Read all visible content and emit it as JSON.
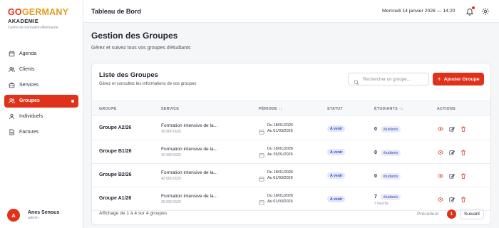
{
  "brand": {
    "go": "GO",
    "rest": "GERMANY",
    "sub": "AKADEMIE",
    "tagline": "Centre de Formation Allemande"
  },
  "sidebar": {
    "items": [
      {
        "label": "Agenda",
        "icon": "calendar-icon"
      },
      {
        "label": "Clients",
        "icon": "users-icon"
      },
      {
        "label": "Services",
        "icon": "briefcase-icon"
      },
      {
        "label": "Groupes",
        "icon": "group-icon",
        "active": true
      },
      {
        "label": "Individuels",
        "icon": "user-icon"
      },
      {
        "label": "Factures",
        "icon": "invoice-icon"
      }
    ]
  },
  "user": {
    "initial": "A",
    "name": "Anes Senous",
    "role": "admin"
  },
  "header": {
    "title": "Tableau de Bord",
    "datetime": "Mercredi 14 janvier 2026 — 14:20"
  },
  "page": {
    "title": "Gestion des Groupes",
    "subtitle": "Gérez et suivez tous vos groupes d'étudiants"
  },
  "card": {
    "title": "Liste des Groupes",
    "subtitle": "Gérez et consultez les informations de vos groupes",
    "search_placeholder": "Rechercher un groupe...",
    "add_label": "Ajouter Groupe"
  },
  "table": {
    "headers": {
      "group": "GROUPE",
      "service": "SERVICE",
      "period": "PÉRIODE",
      "status": "STATUT",
      "students": "ÉTUDIANTS",
      "actions": "ACTIONS",
      "sort_glyph": "↑↓"
    },
    "rows": [
      {
        "group": "Groupe A2/26",
        "service": "Formation intensive de la...",
        "price": "30 000 DZD",
        "from": "Du 18/01/2026",
        "to": "Au 01/03/2026",
        "status": "A venir",
        "count": "0",
        "badge": "étudiants",
        "extra": ""
      },
      {
        "group": "Groupe B1/26",
        "service": "Formation intensive de la...",
        "price": "42 000 DZD",
        "from": "Du 18/01/2026",
        "to": "Au 25/01/2026",
        "status": "A venir",
        "count": "0",
        "badge": "étudiants",
        "extra": ""
      },
      {
        "group": "Groupe B2/26",
        "service": "Formation intensive de la...",
        "price": "42 000 DZD",
        "from": "Du 18/01/2026",
        "to": "Au 01/03/2026",
        "status": "A venir",
        "count": "0",
        "badge": "étudiants",
        "extra": ""
      },
      {
        "group": "Groupe A1/26",
        "service": "Formation intensive de la...",
        "price": "30 000 DZD",
        "from": "Du 18/01/2026",
        "to": "Au 01/03/2026",
        "status": "A venir",
        "count": "7",
        "badge": "étudiants",
        "extra": "7 inscrits"
      }
    ]
  },
  "footer": {
    "summary": "Affichage de 1 à 4 sur 4 groupes",
    "prev": "Précédent",
    "page": "1",
    "next": "Suivant"
  },
  "colors": {
    "accent": "#e0321b",
    "brand_orange": "#e59a1c",
    "badge_blue": "#3a4fc4"
  }
}
